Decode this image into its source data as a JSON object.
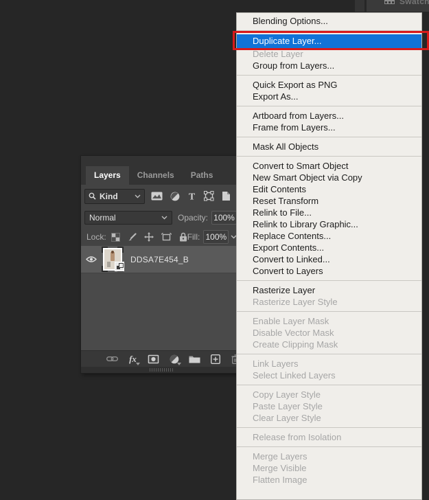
{
  "app": {
    "background_color": "#262626",
    "menu_background": "#f0eeea"
  },
  "top_right_panel": {
    "tab_label": "Swatches",
    "tab_icon": "swatches-grid-icon"
  },
  "layers_panel": {
    "tabs": [
      {
        "label": "Layers",
        "active": true
      },
      {
        "label": "Channels",
        "active": false
      },
      {
        "label": "Paths",
        "active": false
      }
    ],
    "filter_row": {
      "search_icon": "search-icon",
      "kind_label": "Kind",
      "filter_icons": [
        "pixel-layer-filter-icon",
        "adjustment-layer-filter-icon",
        "type-layer-filter-icon",
        "shape-layer-filter-icon",
        "smart-object-filter-icon"
      ]
    },
    "blend_row": {
      "blend_mode": "Normal",
      "opacity_label": "Opacity:",
      "opacity_value": "100%"
    },
    "lock_row": {
      "lock_label": "Lock:",
      "lock_icons": [
        "lock-transparency-icon",
        "lock-paint-icon",
        "lock-move-icon",
        "lock-artboard-icon",
        "lock-all-icon"
      ],
      "fill_label": "Fill:",
      "fill_value": "100%"
    },
    "layers": [
      {
        "name": "DDSA7E454_B",
        "visible": true,
        "selected": true,
        "smart_object": true
      }
    ],
    "bottom_bar_icons": [
      "link-layers-icon",
      "layer-style-fx-icon",
      "add-layer-mask-icon",
      "adjustment-layer-icon",
      "group-folder-icon",
      "new-layer-icon",
      "delete-layer-icon"
    ]
  },
  "context_menu": {
    "highlight_color": "#1173d7",
    "annotation_color": "#d81a1a",
    "sections": [
      {
        "items": [
          {
            "label": "Blending Options...",
            "state": "enabled"
          }
        ]
      },
      {
        "items": [
          {
            "label": "Duplicate Layer...",
            "state": "highlighted",
            "annotated": true
          },
          {
            "label": "Delete Layer",
            "state": "disabled"
          },
          {
            "label": "Group from Layers...",
            "state": "enabled"
          }
        ]
      },
      {
        "items": [
          {
            "label": "Quick Export as PNG",
            "state": "enabled"
          },
          {
            "label": "Export As...",
            "state": "enabled"
          }
        ]
      },
      {
        "items": [
          {
            "label": "Artboard from Layers...",
            "state": "enabled"
          },
          {
            "label": "Frame from Layers...",
            "state": "enabled"
          }
        ]
      },
      {
        "items": [
          {
            "label": "Mask All Objects",
            "state": "enabled"
          }
        ]
      },
      {
        "items": [
          {
            "label": "Convert to Smart Object",
            "state": "enabled"
          },
          {
            "label": "New Smart Object via Copy",
            "state": "enabled"
          },
          {
            "label": "Edit Contents",
            "state": "enabled"
          },
          {
            "label": "Reset Transform",
            "state": "enabled"
          },
          {
            "label": "Relink to File...",
            "state": "enabled"
          },
          {
            "label": "Relink to Library Graphic...",
            "state": "enabled"
          },
          {
            "label": "Replace Contents...",
            "state": "enabled"
          },
          {
            "label": "Export Contents...",
            "state": "enabled"
          },
          {
            "label": "Convert to Linked...",
            "state": "enabled"
          },
          {
            "label": "Convert to Layers",
            "state": "enabled"
          }
        ]
      },
      {
        "items": [
          {
            "label": "Rasterize Layer",
            "state": "enabled"
          },
          {
            "label": "Rasterize Layer Style",
            "state": "disabled"
          }
        ]
      },
      {
        "items": [
          {
            "label": "Enable Layer Mask",
            "state": "disabled"
          },
          {
            "label": "Disable Vector Mask",
            "state": "disabled"
          },
          {
            "label": "Create Clipping Mask",
            "state": "disabled"
          }
        ]
      },
      {
        "items": [
          {
            "label": "Link Layers",
            "state": "disabled"
          },
          {
            "label": "Select Linked Layers",
            "state": "disabled"
          }
        ]
      },
      {
        "items": [
          {
            "label": "Copy Layer Style",
            "state": "disabled"
          },
          {
            "label": "Paste Layer Style",
            "state": "disabled"
          },
          {
            "label": "Clear Layer Style",
            "state": "disabled"
          }
        ]
      },
      {
        "items": [
          {
            "label": "Release from Isolation",
            "state": "disabled"
          }
        ]
      },
      {
        "items": [
          {
            "label": "Merge Layers",
            "state": "disabled"
          },
          {
            "label": "Merge Visible",
            "state": "disabled"
          },
          {
            "label": "Flatten Image",
            "state": "disabled"
          }
        ]
      }
    ]
  }
}
